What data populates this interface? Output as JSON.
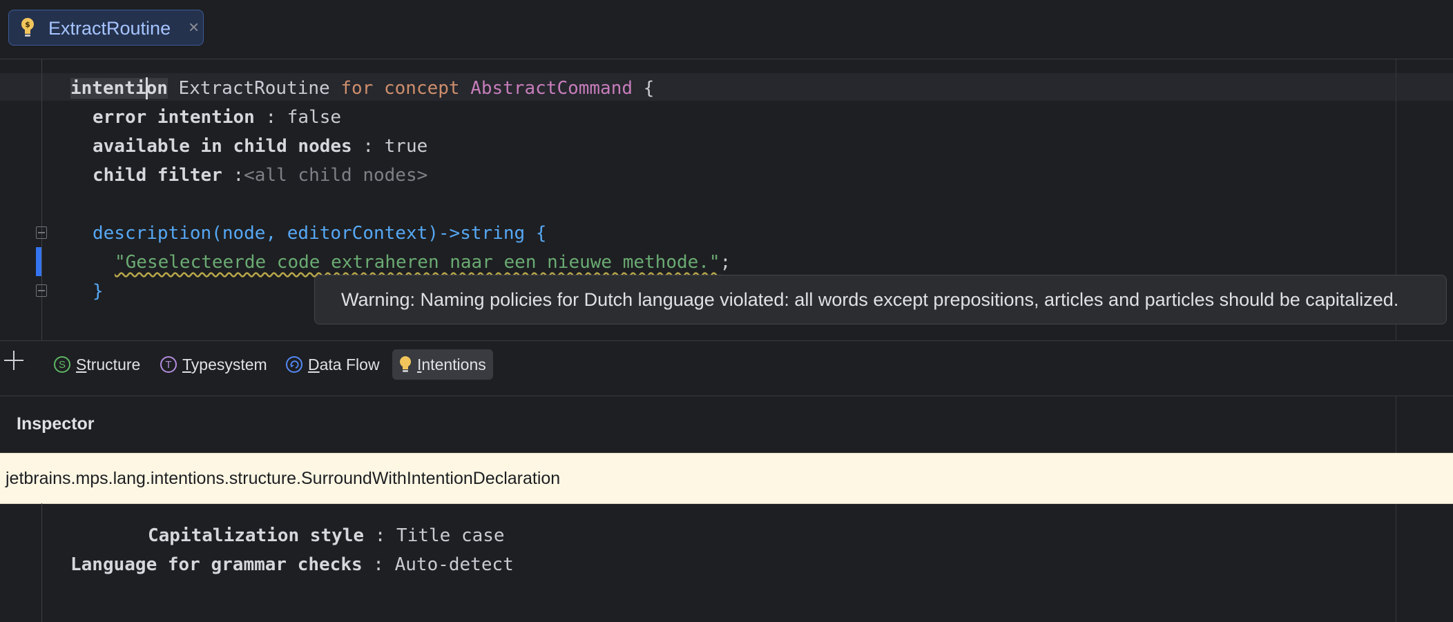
{
  "tab": {
    "title": "ExtractRoutine",
    "close": "×"
  },
  "code": {
    "line1": {
      "kw_a": "intenti",
      "kw_b": "on",
      "name": "ExtractRoutine",
      "for": "for",
      "concept": "concept",
      "concept_name": "AbstractCommand",
      "brace": "{"
    },
    "line2": {
      "key": "error intention",
      "sep": ":",
      "value": "false"
    },
    "line3": {
      "key": "available in child nodes",
      "sep": ":",
      "value": "true"
    },
    "line4": {
      "key": "child filter",
      "sep": ":",
      "value": "<all child nodes>"
    },
    "line6": {
      "signature": "description(node, editorContext)->string {"
    },
    "line7": {
      "string": "\"Geselecteerde code extraheren naar een nieuwe methode.\"",
      "semi": ";"
    },
    "line8": {
      "brace": "}"
    }
  },
  "tooltip": {
    "text": "Warning: Naming policies for Dutch language violated: all words except prepositions, articles and particles should be capitalized."
  },
  "aspect_tabs": [
    {
      "icon": "S",
      "mnemonic": "S",
      "rest": "tructure"
    },
    {
      "icon": "T",
      "mnemonic": "T",
      "rest": "ypesystem"
    },
    {
      "icon": "",
      "mnemonic": "D",
      "rest": "ata Flow"
    },
    {
      "icon": "bulb",
      "mnemonic": "I",
      "rest": "ntentions"
    }
  ],
  "inspector": {
    "title": "Inspector",
    "fqn": "jetbrains.mps.lang.intentions.structure.SurroundWithIntentionDeclaration",
    "props": [
      {
        "key": "Capitalization style",
        "sep": ":",
        "value": "Title case"
      },
      {
        "key": "Language for grammar checks",
        "sep": ":",
        "value": "Auto-detect"
      }
    ]
  },
  "colors": {
    "accent": "#3574f0",
    "tab_bg": "#25324d",
    "inspector_bar": "#fdf7e4"
  }
}
